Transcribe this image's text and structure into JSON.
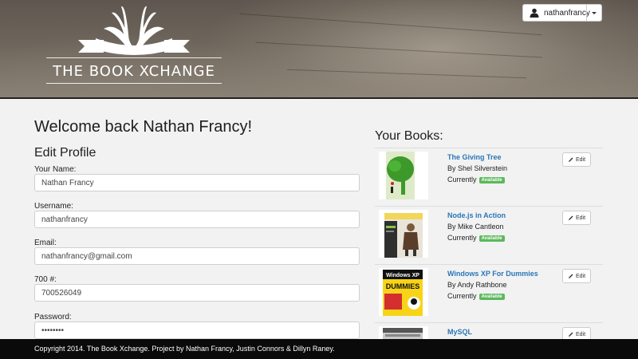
{
  "header": {
    "logo_text": "THE BOOK XCHANGE",
    "user": {
      "name": "nathanfrancy",
      "icon": "user-icon"
    }
  },
  "profile": {
    "welcome": "Welcome back Nathan Francy!",
    "heading": "Edit Profile",
    "fields": [
      {
        "label": "Your Name:",
        "value": "Nathan Francy"
      },
      {
        "label": "Username:",
        "value": "nathanfrancy"
      },
      {
        "label": "Email:",
        "value": "nathanfrancy@gmail.com"
      },
      {
        "label": "700 #:",
        "value": "700526049"
      },
      {
        "label": "Password:",
        "value": "••••••••"
      }
    ]
  },
  "books": {
    "heading": "Your Books:",
    "edit_label": "Edit",
    "status_prefix": "Currently",
    "items": [
      {
        "title": "The Giving Tree",
        "author": "By Shel Silverstein",
        "status": "Available",
        "cover_icon": "giving-tree-cover"
      },
      {
        "title": "Node.js in Action",
        "author": "By Mike Cantleon",
        "status": "Available",
        "cover_icon": "nodejs-cover"
      },
      {
        "title": "Windows XP For Dummies",
        "author": "By Andy Rathbone",
        "status": "Available",
        "cover_icon": "windows-xp-cover",
        "cover_text_1": "Windows XP",
        "cover_text_2": "DUMMIES"
      },
      {
        "title": "MySQL",
        "author": "",
        "status": "",
        "cover_icon": "mysql-cover"
      }
    ]
  },
  "colors": {
    "accent": "#2a76b8",
    "badge": "#5cb85c",
    "footer": "#0a0a0a"
  },
  "footer": {
    "text": "Copyright 2014. The Book Xchange. Project by Nathan Francy, Justin Connors & Dillyn Raney."
  }
}
